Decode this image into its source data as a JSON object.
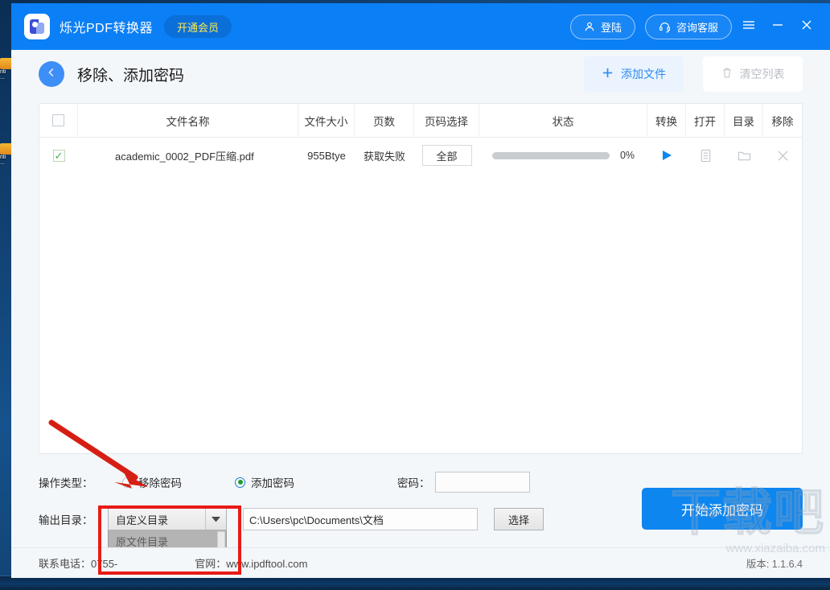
{
  "titlebar": {
    "app_name": "烁光PDF转换器",
    "vip_label": "开通会员",
    "login_label": "登陆",
    "support_label": "咨询客服",
    "menu_icon": "hamburger-icon",
    "minimize_icon": "minimize-icon",
    "close_icon": "close-icon",
    "bg_color": "#0b7ff5",
    "vip_text_color": "#ffe94d"
  },
  "page": {
    "title": "移除、添加密码",
    "back_icon": "back-arrow-icon",
    "add_file_label": "添加文件",
    "clear_list_label": "清空列表",
    "add_file_icon": "plus-icon",
    "clear_list_icon": "trash-icon"
  },
  "table": {
    "columns": [
      {
        "key": "checkbox",
        "label": ""
      },
      {
        "key": "name",
        "label": "文件名称"
      },
      {
        "key": "size",
        "label": "文件大小"
      },
      {
        "key": "pages",
        "label": "页数"
      },
      {
        "key": "page_select",
        "label": "页码选择"
      },
      {
        "key": "status",
        "label": "状态"
      },
      {
        "key": "convert",
        "label": "转换"
      },
      {
        "key": "open",
        "label": "打开"
      },
      {
        "key": "dir",
        "label": "目录"
      },
      {
        "key": "remove",
        "label": "移除"
      }
    ],
    "header_checkbox_checked": false,
    "rows": [
      {
        "checked": true,
        "name": "academic_0002_PDF压缩.pdf",
        "size": "955Btye",
        "pages": "获取失败",
        "page_select": "全部",
        "progress": 0,
        "progress_label": "0%",
        "convert_icon": "play-icon",
        "open_icon": "document-icon",
        "dir_icon": "folder-icon",
        "remove_icon": "close-x-icon"
      }
    ]
  },
  "options": {
    "operation_type_label": "操作类型：",
    "remove_password_label": "移除密码",
    "add_password_label": "添加密码",
    "selected_operation": "添加密码",
    "password_label": "密码：",
    "password_value": "",
    "output_dir_label": "输出目录：",
    "output_mode_selected": "自定义目录",
    "output_mode_options": [
      "原文件目录",
      "自定义目录"
    ],
    "dropdown_open": true,
    "dropdown_arrow_icon": "caret-down-icon",
    "path_value": "C:\\Users\\pc\\Documents\\文档",
    "choose_label": "选择",
    "start_button_label": "开始添加密码",
    "start_button_color": "#0d86f0"
  },
  "footer": {
    "phone": "联系电话：0755-",
    "website": "官网：www.ipdftool.com",
    "version": "版本: 1.1.6.4"
  },
  "watermark": {
    "big": "下载吧",
    "small": "www.xiazaiba.com"
  },
  "desktop": {
    "icons": [
      {
        "caption": "nti",
        "sub": "..."
      },
      {
        "caption": "nti",
        "sub": "..."
      }
    ]
  },
  "annotations": {
    "red_box_target": "output-dir-dropdown",
    "red_arrow_target": "remove-password-radio",
    "color": "#e81b17"
  }
}
